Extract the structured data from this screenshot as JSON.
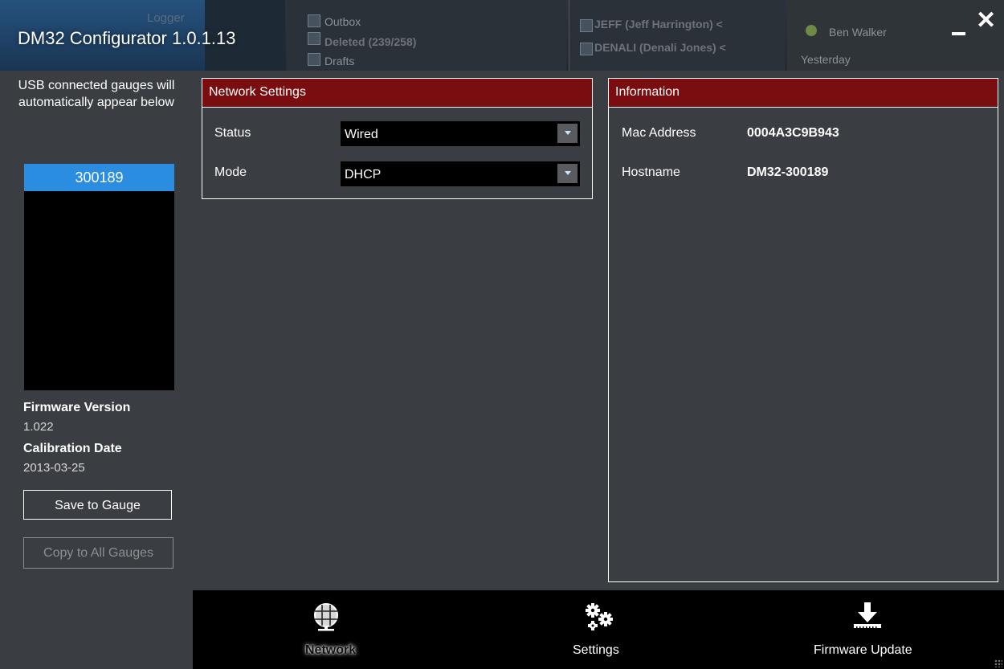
{
  "window": {
    "title": "DM32 Configurator 1.0.1.13",
    "minimize_glyph": "_",
    "close_glyph": "✕"
  },
  "background_window": {
    "logger_text": "Logger",
    "folders": [
      "Outbox",
      "Deleted (239/258)",
      "Drafts"
    ],
    "messages": [
      "JEFF (Jeff Harrington) <",
      "DENALI (Denali Jones) <"
    ],
    "contacts": [
      "Ben Walker"
    ],
    "group_label": "Yesterday"
  },
  "sidebar": {
    "usb_hint": "USB connected gauges will automatically appear below",
    "gauges": [
      "300189"
    ],
    "firmware_version_label": "Firmware Version",
    "firmware_version": "1.022",
    "calibration_date_label": "Calibration Date",
    "calibration_date": "2013-03-25",
    "save_button": "Save to Gauge",
    "copy_button": "Copy to All Gauges"
  },
  "network_settings": {
    "header": "Network Settings",
    "status_label": "Status",
    "status_value": "Wired",
    "mode_label": "Mode",
    "mode_value": "DHCP"
  },
  "information": {
    "header": "Information",
    "mac_label": "Mac Address",
    "mac_value": "0004A3C9B943",
    "hostname_label": "Hostname",
    "hostname_value": "DM32-300189"
  },
  "bottom_nav": {
    "items": [
      {
        "label": "Network",
        "icon": "globe-icon",
        "active": true
      },
      {
        "label": "Settings",
        "icon": "gears-icon",
        "active": false
      },
      {
        "label": "Firmware Update",
        "icon": "download-arrow-icon",
        "active": false
      }
    ]
  },
  "colors": {
    "accent_red": "#7a0d0f",
    "selection_blue": "#2a8de0",
    "background": "#3a3d41"
  }
}
